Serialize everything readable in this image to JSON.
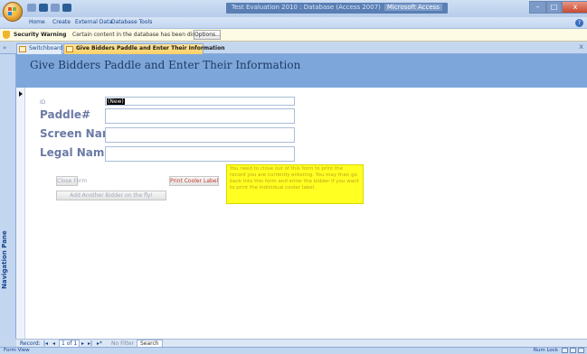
{
  "window": {
    "title": "Test Evaluation 2010 : Database (Access 2007)",
    "app_name": "Microsoft Access",
    "controls": {
      "minimize": "–",
      "maximize": "□",
      "close": "x"
    }
  },
  "ribbon": {
    "tabs": [
      "Home",
      "Create",
      "External Data",
      "Database Tools"
    ]
  },
  "message_bar": {
    "title": "Security Warning",
    "text": "Certain content in the database has been disabled",
    "options_label": "Options..."
  },
  "document_tabs": {
    "items": [
      {
        "label": "Switchboard",
        "active": false
      },
      {
        "label": "Give Bidders Paddle and Enter Their Information",
        "active": true
      }
    ],
    "close_glyph": "x"
  },
  "nav_pane": {
    "label": "Navigation Pane"
  },
  "form": {
    "title": "Give Bidders Paddle and Enter Their Information",
    "fields": {
      "id_label": "ID",
      "id_value": "(New)",
      "paddle_label": "Paddle#",
      "paddle_value": "",
      "screen_name_label": "Screen Name",
      "screen_name_value": "",
      "legal_name_label": "Legal Name",
      "legal_name_value": ""
    },
    "buttons": {
      "close_form": "Close Form",
      "print_cooler_label": "Print Cooler Label",
      "add_another_bidder": "Add Another Bidder on the fly!"
    },
    "note": "You need to close out of this form to print the record you are currently entering.  You may then go back into this form and enter the bidder if you want to print the individual cooler label."
  },
  "record_nav": {
    "prefix": "Record:",
    "first": "|◂",
    "prev": "◂",
    "position": "1 of 1",
    "next": "▸",
    "last": "▸|",
    "new": "▸*",
    "filter_label": "No Filter",
    "search_label": "Search"
  },
  "status_bar": {
    "left": "Form View",
    "right": "Num Lock"
  },
  "colors": {
    "header_bg": "#7da7db",
    "title_text": "#1f3a63",
    "note_bg": "#ffff22",
    "active_tab": "#ffd065"
  }
}
